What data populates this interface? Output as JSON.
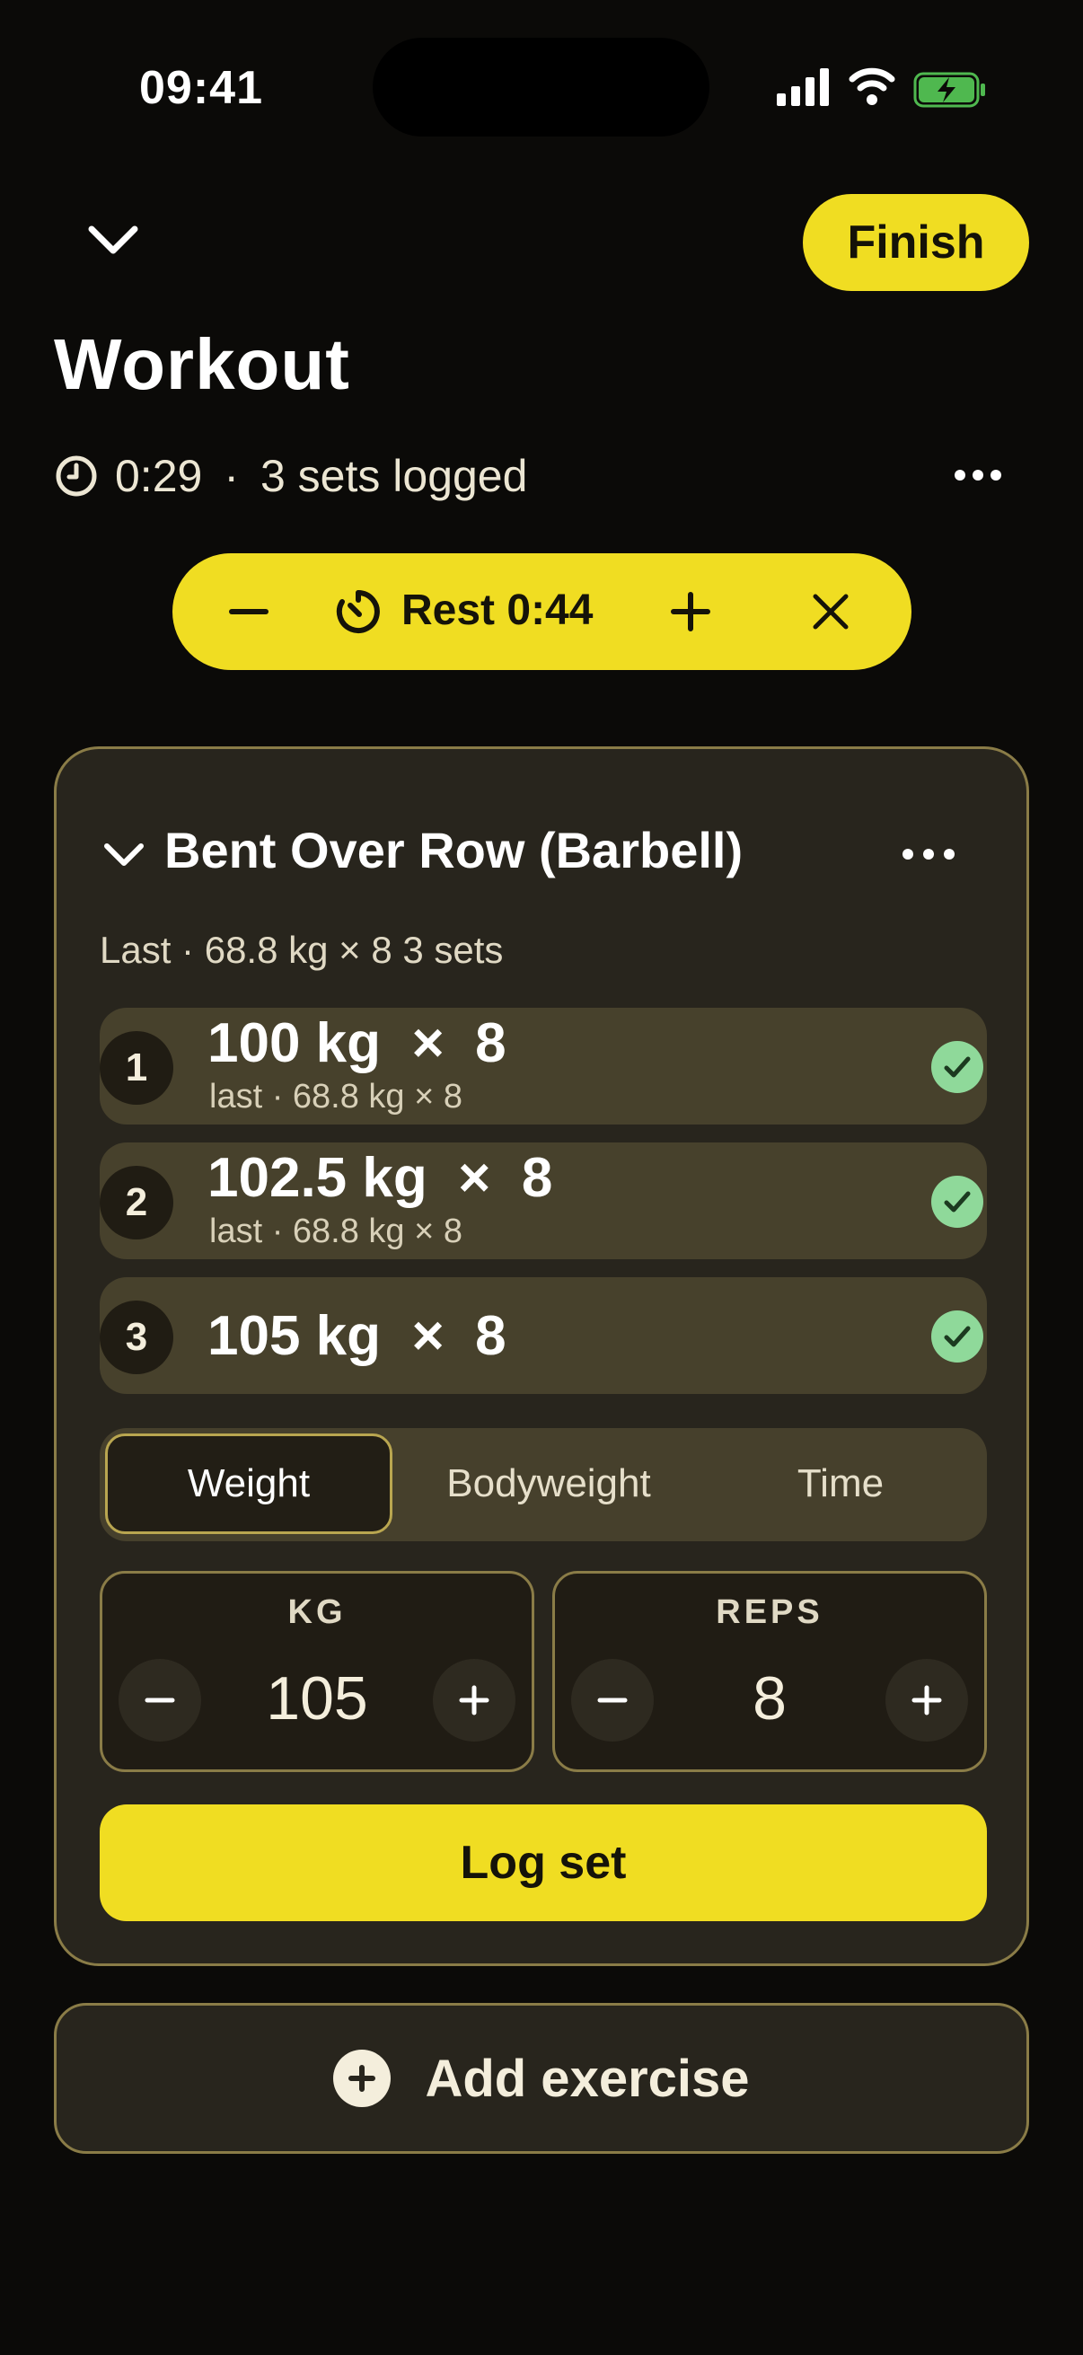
{
  "status": {
    "time": "09:41"
  },
  "header": {
    "finish_label": "Finish",
    "title": "Workout",
    "elapsed": "0:29",
    "separator": "·",
    "sets_logged": "3 sets logged"
  },
  "rest": {
    "label": "Rest 0:44"
  },
  "exercise": {
    "name": "Bent Over Row (Barbell)",
    "last_summary": "Last · 68.8 kg × 8  3 sets",
    "sets": [
      {
        "number": "1",
        "main": "100 kg  ×  8",
        "sub": "last · 68.8 kg × 8"
      },
      {
        "number": "2",
        "main": "102.5 kg  ×  8",
        "sub": "last · 68.8 kg × 8"
      },
      {
        "number": "3",
        "main": "105 kg  ×  8",
        "sub": ""
      }
    ],
    "modes": [
      "Weight",
      "Bodyweight",
      "Time"
    ],
    "active_mode": "Weight",
    "weight": {
      "label": "KG",
      "value": "105"
    },
    "reps": {
      "label": "REPS",
      "value": "8"
    },
    "log_label": "Log set"
  },
  "add_exercise_label": "Add exercise",
  "colors": {
    "accent": "#f0dd22",
    "background": "#0b0a08",
    "card": "#28251d",
    "check": "#8fd99a"
  }
}
